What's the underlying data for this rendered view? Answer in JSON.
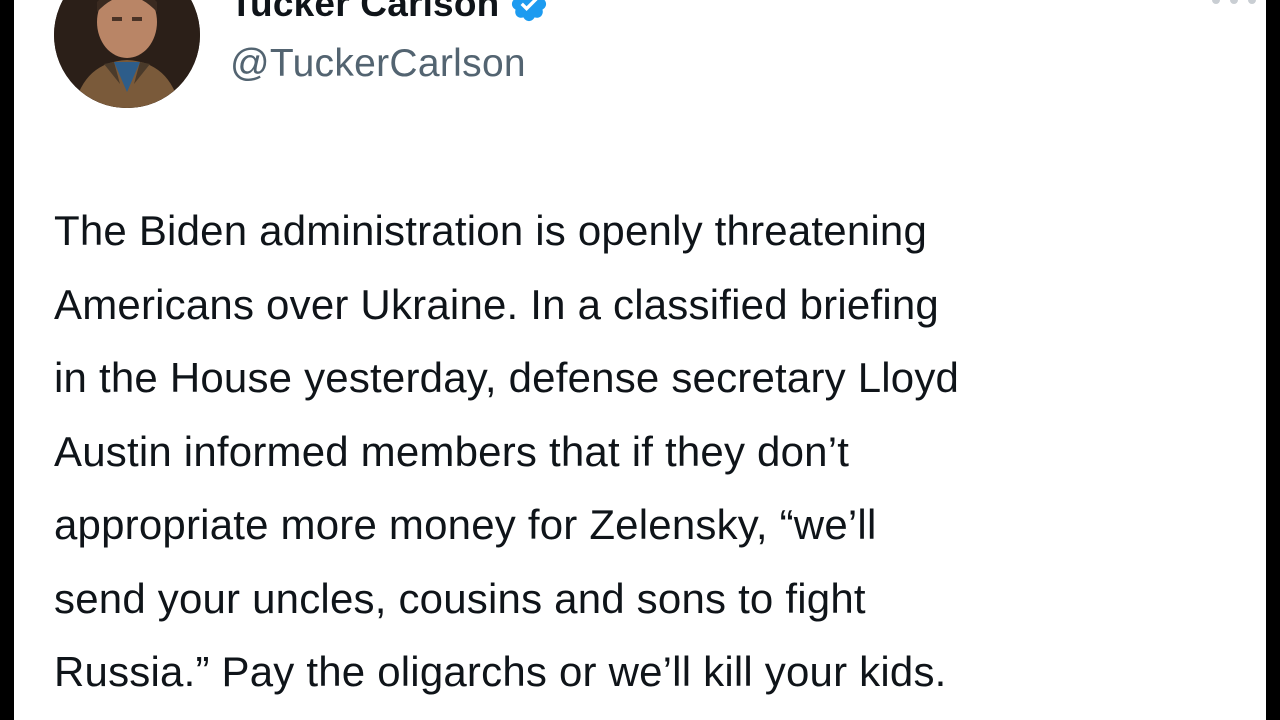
{
  "tweet": {
    "author": {
      "display_name": "Tucker Carlson",
      "handle": "@TuckerCarlson",
      "verified": true,
      "verified_icon": "verified-badge-icon"
    },
    "more_icon": "more-options-icon",
    "text_lines": [
      "The Biden administration is openly threatening",
      "Americans over Ukraine. In a classified briefing",
      "in the House yesterday, defense secretary Lloyd",
      "Austin informed members that if they don’t",
      "appropriate more money for Zelensky, “we’ll",
      "send your uncles, cousins and sons to fight",
      "Russia.” Pay the oligarchs or we’ll kill your kids."
    ]
  },
  "colors": {
    "background": "#ffffff",
    "outer_frame": "#000000",
    "text_primary": "#0f1419",
    "text_secondary": "#536471",
    "verified_blue": "#1d9bf0"
  }
}
